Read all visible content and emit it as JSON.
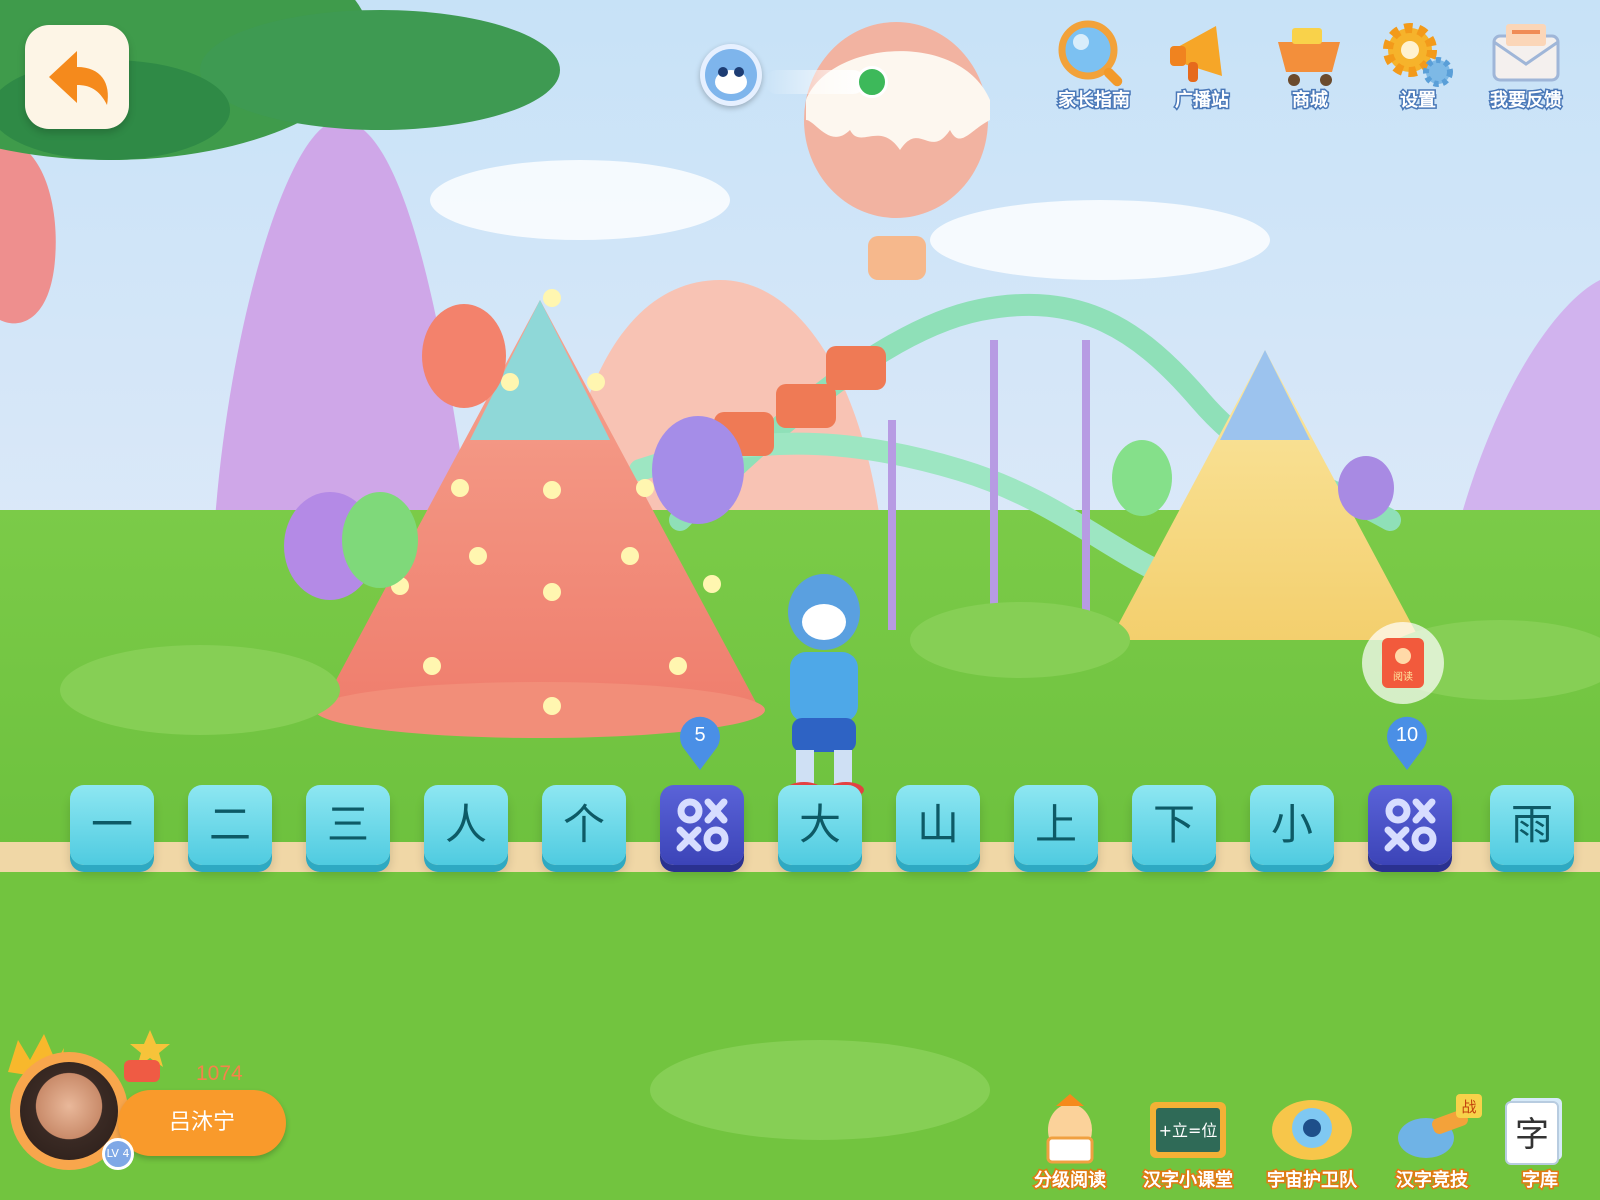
{
  "toolbar": {
    "items": [
      {
        "label": "家长指南",
        "icon": "magnifier-icon"
      },
      {
        "label": "广播站",
        "icon": "megaphone-icon"
      },
      {
        "label": "商城",
        "icon": "shopping-cart-icon"
      },
      {
        "label": "设置",
        "icon": "gear-icon"
      },
      {
        "label": "我要反馈",
        "icon": "envelope-icon"
      }
    ]
  },
  "path": {
    "tiles": [
      "一",
      "二",
      "三",
      "人",
      "个",
      "",
      "大",
      "山",
      "上",
      "下",
      "小",
      "",
      "雨"
    ],
    "markers": [
      "5",
      "10"
    ]
  },
  "reading_badge": {
    "label": "阅读"
  },
  "user": {
    "name": "吕沐宁",
    "points": "1074",
    "level": "LV 4"
  },
  "bottom_menu": {
    "items": [
      {
        "label": "分级阅读"
      },
      {
        "label": "汉字小课堂",
        "board_text": "+立=位"
      },
      {
        "label": "宇宙护卫队"
      },
      {
        "label": "汉字竞技",
        "badge": "战"
      },
      {
        "label": "字库",
        "glyph": "字"
      }
    ]
  },
  "colors": {
    "sky": "#cfe6f7",
    "grass": "#6fc33f",
    "tile": "#5fd3e6",
    "game_tile": "#3f48c0",
    "accent_orange": "#f99a2b"
  }
}
